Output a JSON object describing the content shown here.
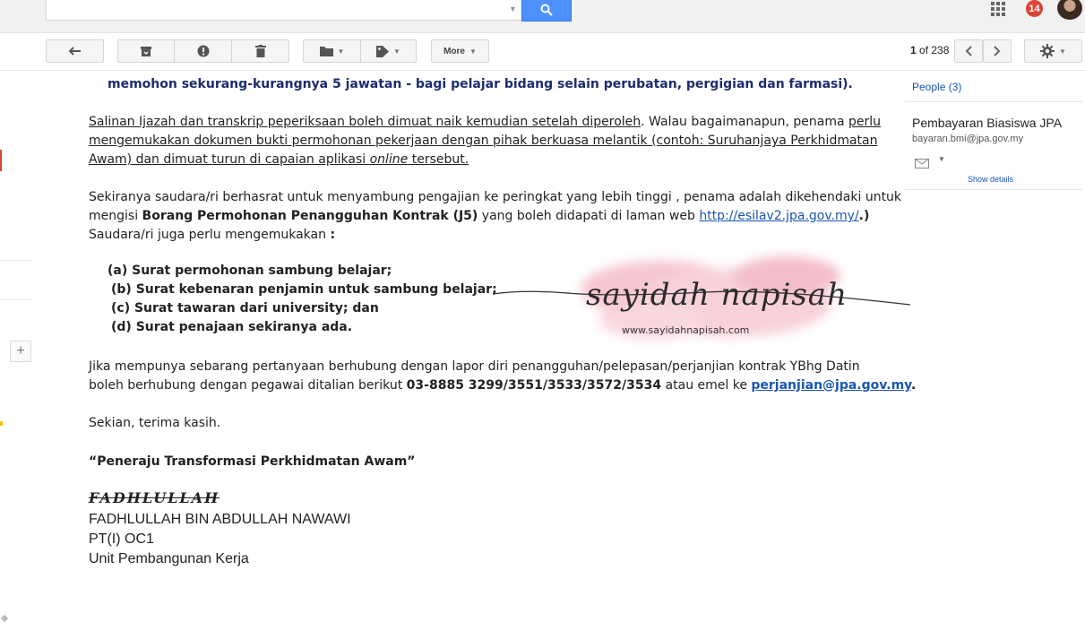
{
  "topbar": {
    "notification_count": "14",
    "icons": [
      "search-icon",
      "apps-grid-icon",
      "avatar"
    ]
  },
  "toolbar": {
    "more_label": "More",
    "icons": [
      "back-arrow-icon",
      "archive-icon",
      "report-spam-icon",
      "delete-icon",
      "folder-icon",
      "label-icon",
      "gear-icon",
      "chevron-left-icon",
      "chevron-right-icon"
    ]
  },
  "pager": {
    "current": "1",
    "of_text": "of 238"
  },
  "email": {
    "line_top": "memohon sekurang-kurangnya 5 jawatan - bagi pelajar bidang selain perubatan, pergigian dan farmasi).",
    "p1_l1_u": "Salinan Ijazah dan transkrip peperiksaan boleh dimuat naik kemudian setelah diperoleh",
    "p1_l1_mid": ". Walau bagaimanapun, penama ",
    "p1_l1_u2": "perlu",
    "p1_l2": "mengemukakan dokumen bukti permohonan pekerjaan dengan pihak berkuasa melantik (contoh: Suruhanjaya Perkhidmatan",
    "p1_l3_a": "Awam) dan dimuat turun di capaian aplikasi ",
    "p1_l3_i": "online",
    "p1_l3_b": " tersebut.",
    "p2_l1": "Sekiranya saudara/ri berhasrat untuk menyambung pengajian ke peringkat yang lebih tinggi , penama adalah dikehendaki untuk",
    "p2_l2_a": "mengisi ",
    "p2_l2_b": "Borang Permohonan Penangguhan Kontrak (J5)",
    "p2_l2_c": " yang boleh didapati di laman web ",
    "p2_l2_link": "http://esilav2.jpa.gov.my/",
    "p2_l2_d": ".)",
    "p2_l3_a": "Saudara/ri juga perlu   mengemukakan ",
    "p2_l3_b": ":",
    "list": [
      "(a) Surat permohonan sambung belajar;",
      "(b)   Surat kebenaran penjamin untuk sambung belajar;",
      "(c)   Surat tawaran dari university; dan",
      "(d)   Surat penajaan sekiranya ada."
    ],
    "p3_l1": "Jika mempunya sebarang pertanyaan berhubung dengan lapor diri penangguhan/pelepasan/perjanjian kontrak YBhg Datin",
    "p3_l2_a": "boleh berhubung dengan pegawai ditalian berikut ",
    "p3_l2_b": "03-8885 3299/3551/3533/3572/3534",
    "p3_l2_c": " atau emel ke ",
    "p3_l2_link": "perjanjian@jpa.gov.my",
    "p3_l2_d": ".",
    "closing": "Sekian, terima kasih.",
    "slogan": "“Peneraju Transformasi Perkhidmatan Awam”",
    "sig_script": "FADHLULLAH",
    "sig_name": "FADHLULLAH BIN ABDULLAH NAWAWI",
    "sig_title": "PT(I) OC1",
    "sig_unit": "Unit Pembangunan Kerja"
  },
  "watermark": {
    "name": "sayidah napisah",
    "url": "www.sayidahnapisah.com"
  },
  "right_panel": {
    "people_label": "People (3)",
    "contact_name": "Pembayaran Biasiswa JPA",
    "contact_email": "bayaran.bmi@jpa.gov.my",
    "show_details": "Show details"
  },
  "colors": {
    "search_blue": "#4d90fe",
    "badge_red": "#db4437",
    "link_blue": "#1a55b3",
    "navy_text": "#1c2c6e",
    "watermark_pink": "#f3b3c3"
  }
}
